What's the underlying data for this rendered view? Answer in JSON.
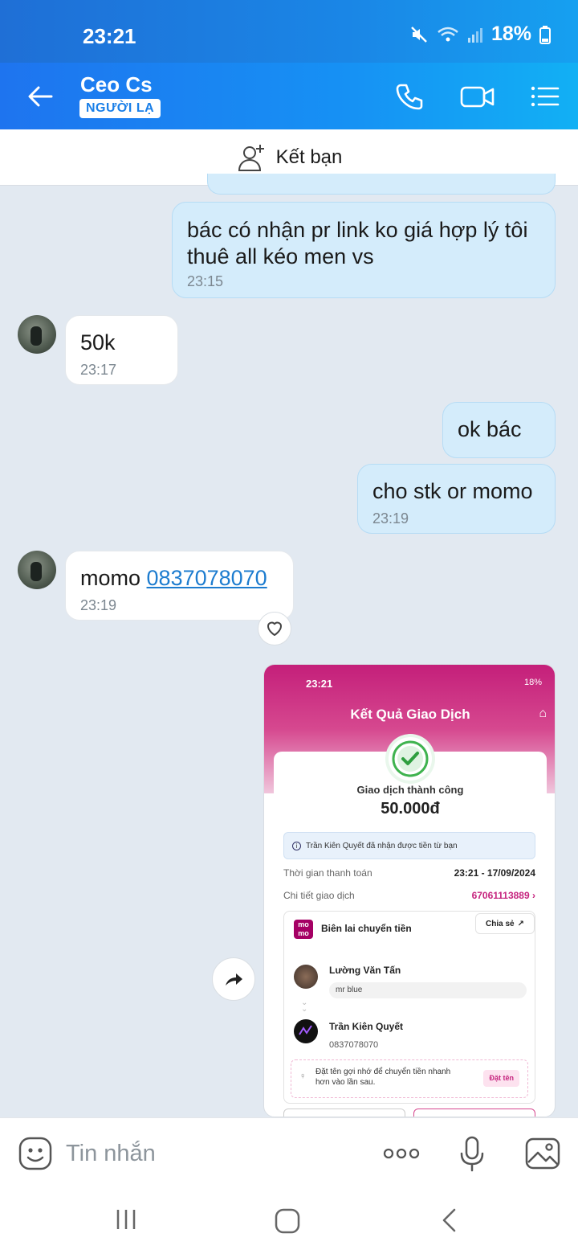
{
  "status": {
    "time": "23:21",
    "battery": "18%"
  },
  "header": {
    "name": "Ceo Cs",
    "badge": "NGƯỜI LẠ"
  },
  "friend_bar": {
    "label": "Kết bạn"
  },
  "messages": [
    {
      "from": "me",
      "text": "bác có nhận pr link ko giá hợp lý tôi thuê all kéo men vs",
      "time": "23:15"
    },
    {
      "from": "them",
      "text": "50k",
      "time": "23:17"
    },
    {
      "from": "me",
      "text": "ok bác",
      "time": ""
    },
    {
      "from": "me",
      "text": "cho stk or momo",
      "time": "23:19"
    },
    {
      "from": "them",
      "text_prefix": "momo ",
      "link": "0837078070",
      "time": "23:19"
    }
  ],
  "momo_screenshot": {
    "time": "23:21",
    "status": "18%",
    "title": "Kết Quả Giao Dịch",
    "success": "Giao dịch thành công",
    "amount": "50.000đ",
    "info": "Trần Kiên Quyết đã nhận được tiền từ bạn",
    "pay_time_label": "Thời gian thanh toán",
    "pay_time_value": "23:21 - 17/09/2024",
    "detail_label": "Chi tiết giao dịch",
    "detail_value": "67061113889",
    "logo": "mo mo",
    "receipt_label": "Biên lai chuyển tiền",
    "share_label": "Chia sẻ",
    "sender_name": "Lường Văn Tấn",
    "memo": "mr blue",
    "receiver_name": "Trần Kiên Quyết",
    "receiver_phone": "0837078070",
    "hint": "Đặt tên gợi nhớ để chuyển tiền nhanh hơn vào lần sau.",
    "hint_button": "Đặt tên"
  },
  "input": {
    "placeholder": "Tin nhắn"
  },
  "colors": {
    "accent": "#1a86e6",
    "my_bubble": "#d4ecfb",
    "momo_pink": "#c41f7a"
  },
  "icons": [
    "back-arrow-icon",
    "phone-icon",
    "video-call-icon",
    "menu-list-icon",
    "add-friend-icon",
    "heart-icon",
    "share-icon",
    "emoji-icon",
    "more-icon",
    "microphone-icon",
    "image-icon"
  ]
}
